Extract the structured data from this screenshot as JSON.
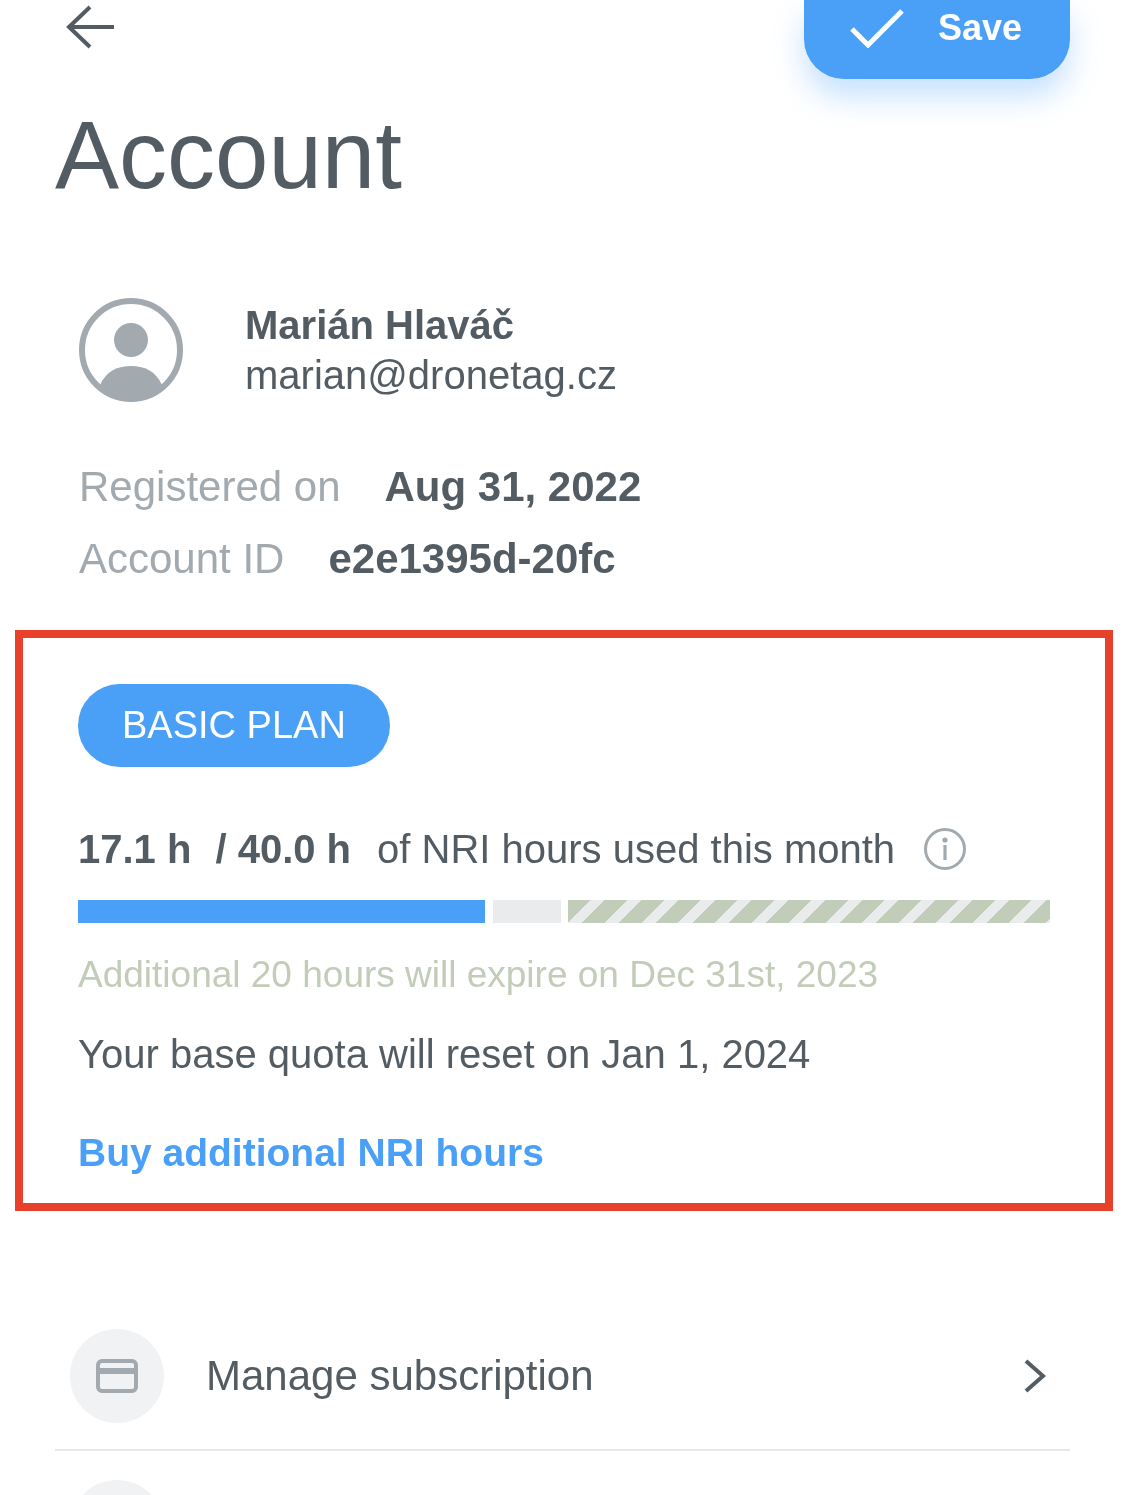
{
  "header": {
    "save_label": "Save"
  },
  "title": "Account",
  "profile": {
    "name": "Marián Hlaváč",
    "email": "marian@dronetag.cz"
  },
  "details": [
    {
      "label": "Registered on",
      "value": "Aug 31, 2022"
    },
    {
      "label": "Account ID",
      "value": "e2e1395d-20fc"
    }
  ],
  "plan": {
    "highlighted": true,
    "badge": "BASIC PLAN",
    "used": "17.1 h",
    "limit": "/ 40.0 h",
    "caption": "of NRI hours used this month",
    "quota_bar": {
      "level": 0.86
    },
    "has_additional_hours": true,
    "expiry_note": "Additional 20 hours will expire on Dec 31st, 2023",
    "reset_note": "Your base quota will reset on Jan 1, 2024",
    "link": "Buy additional NRI hours"
  },
  "menu": {
    "items": [
      {
        "kind": "card",
        "label": "Manage subscription"
      }
    ],
    "more_below": true
  }
}
